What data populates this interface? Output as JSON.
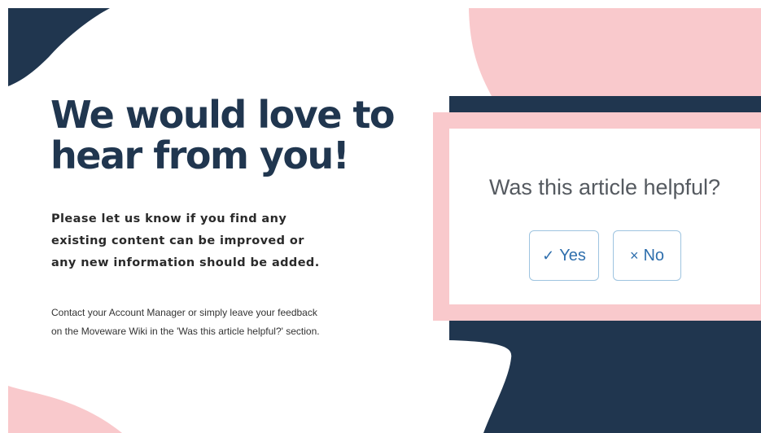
{
  "headline": {
    "line1": "We would love to",
    "line2": "hear from you!"
  },
  "subtext": {
    "line1": "Please let us know if you find any",
    "line2": "existing content can be improved or",
    "line3": "any new information should be added."
  },
  "contact": {
    "line1": "Contact your Account Manager or simply leave your feedback",
    "line2": "on the Moveware Wiki in the 'Was this article helpful?' section."
  },
  "feedback_widget": {
    "question": "Was this article helpful?",
    "yes_icon": "check-icon",
    "yes_glyph": "✓",
    "yes_label": "Yes",
    "no_icon": "times-icon",
    "no_glyph": "×",
    "no_label": "No"
  },
  "colors": {
    "navy": "#20364f",
    "pink": "#f9c9cc",
    "button_border": "#9ec4e0",
    "button_text": "#2f6fad"
  }
}
